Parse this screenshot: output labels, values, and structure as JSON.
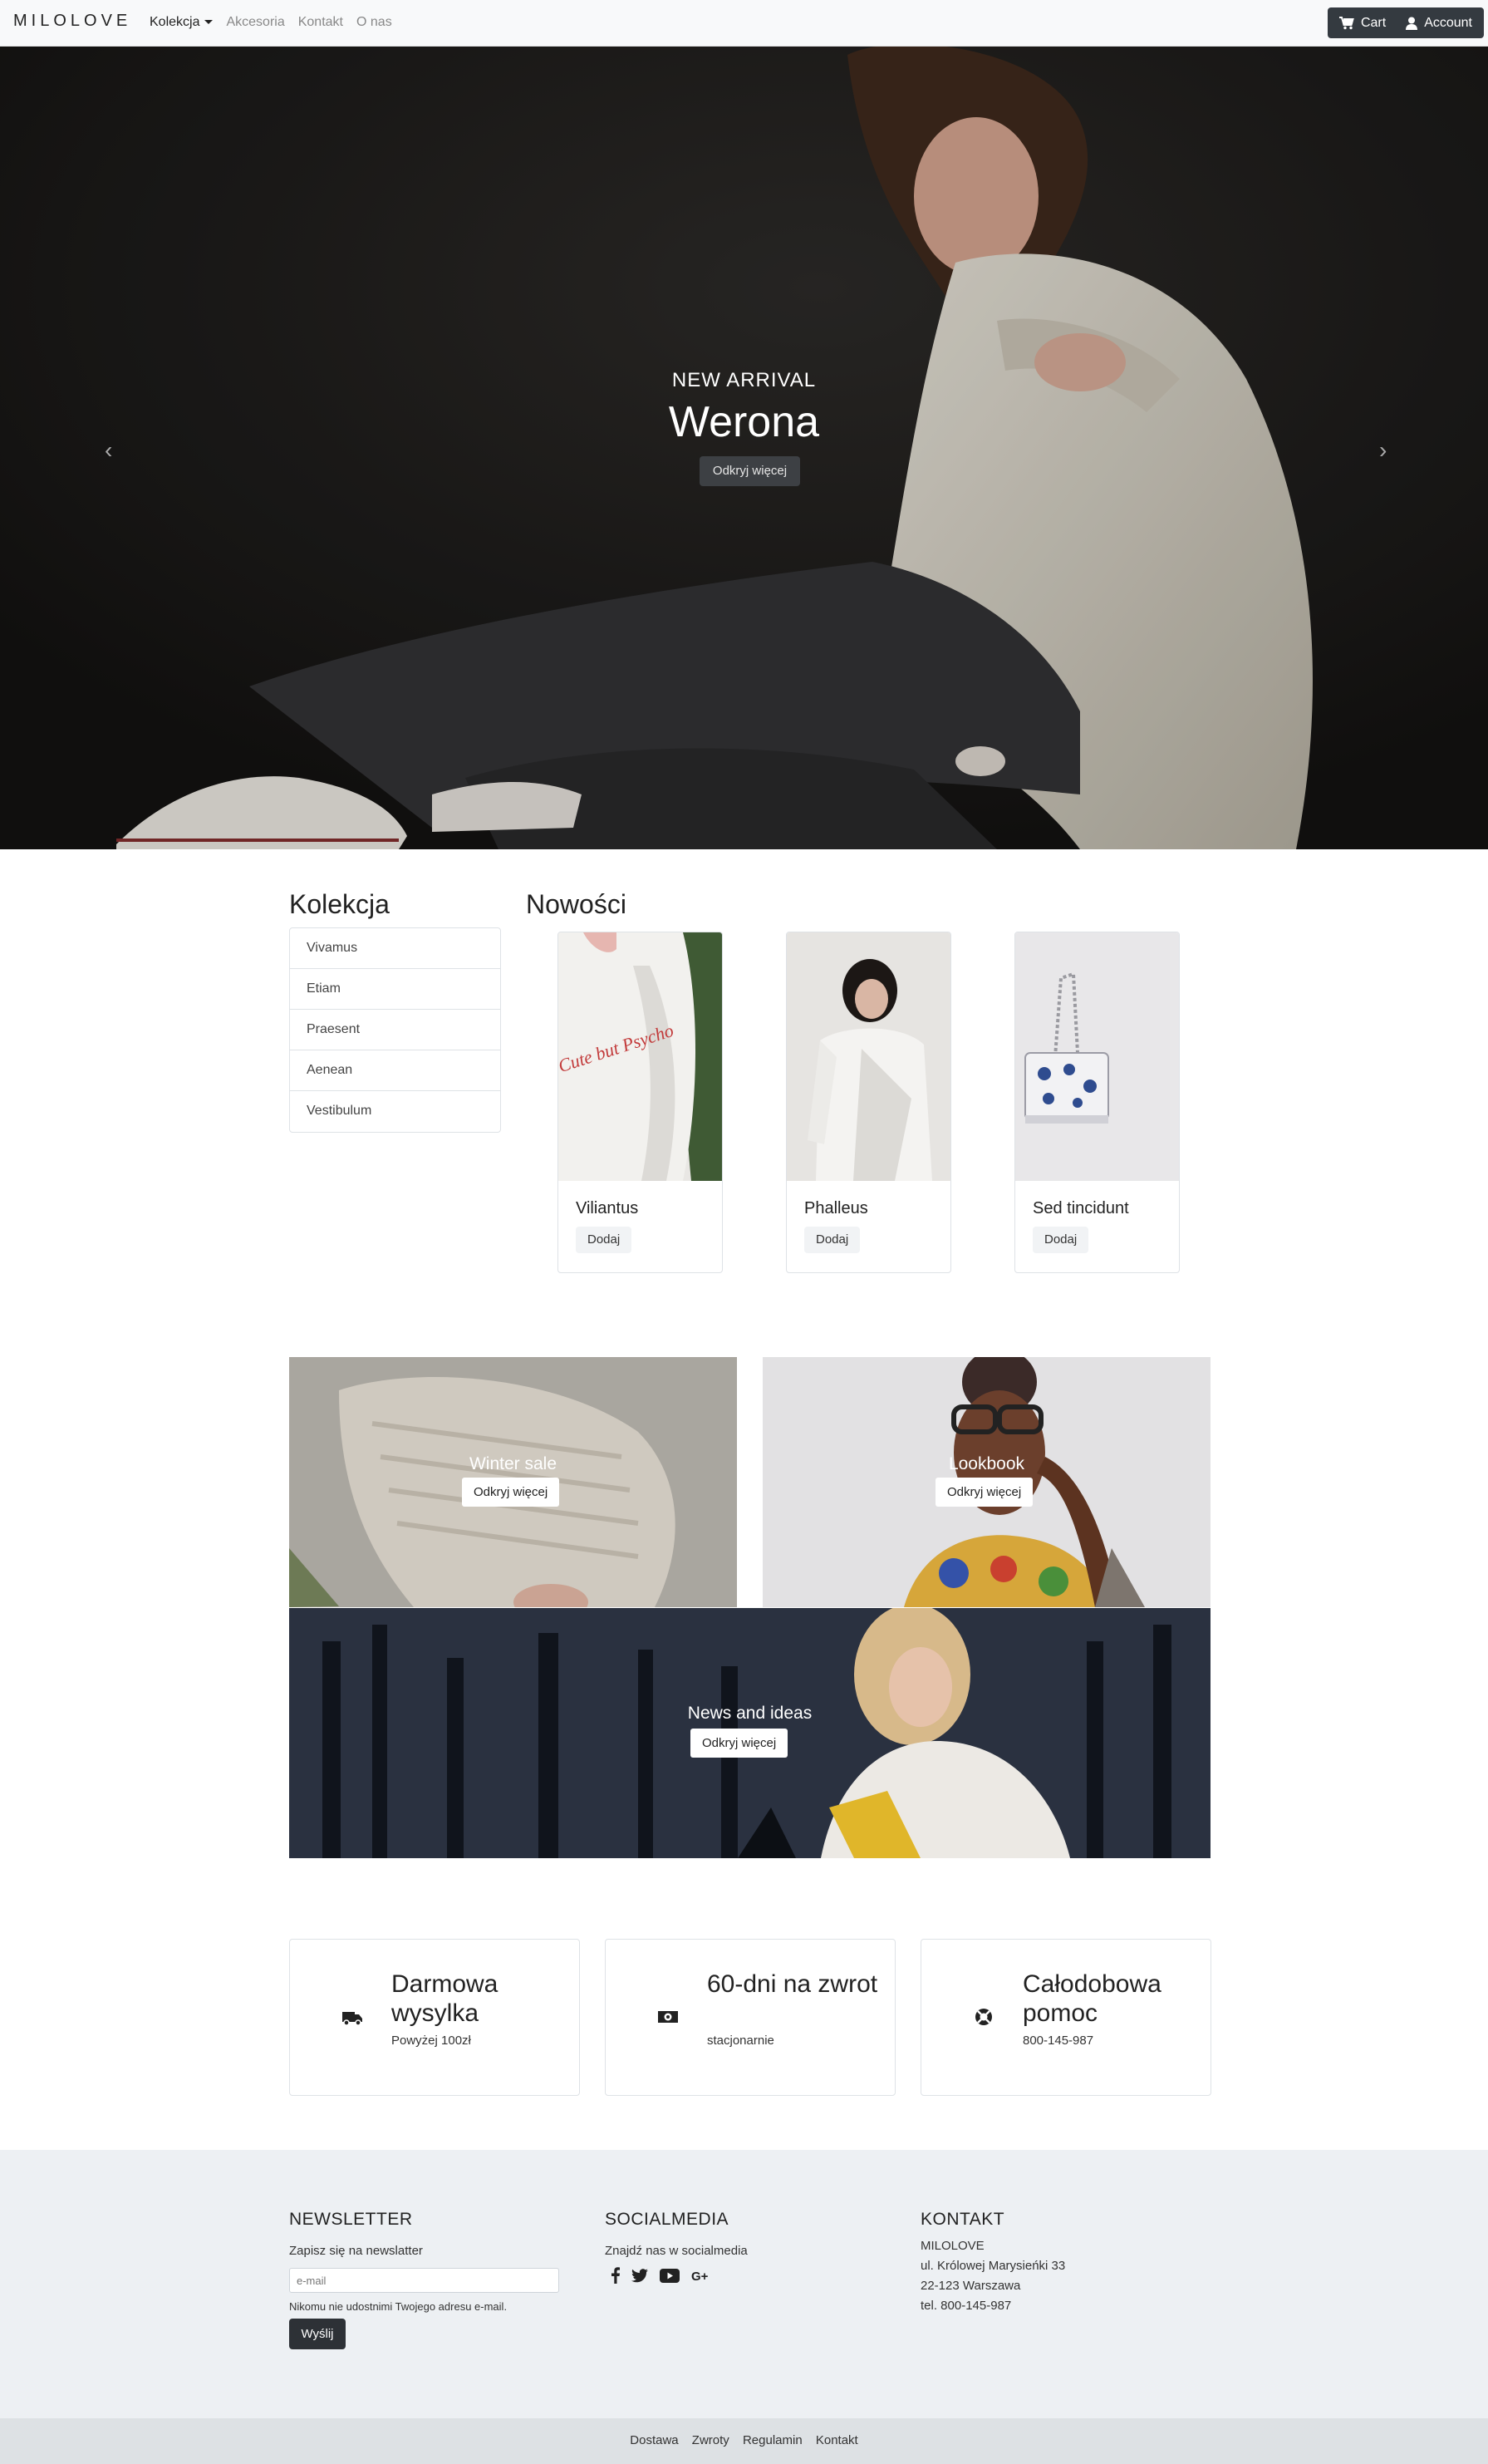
{
  "nav": {
    "brand": "MILOLOVE",
    "links": [
      "Kolekcja",
      "Akcesoria",
      "Kontakt",
      "O nas"
    ],
    "cart": "Cart",
    "account": "Account"
  },
  "hero": {
    "subtitle": "NEW ARRIVAL",
    "title": "Werona",
    "button": "Odkryj więcej"
  },
  "collection": {
    "heading": "Kolekcja",
    "items": [
      "Vivamus",
      "Etiam",
      "Praesent",
      "Aenean",
      "Vestibulum"
    ]
  },
  "news": {
    "heading": "Nowości",
    "products": [
      {
        "name": "Viliantus",
        "button": "Dodaj",
        "print": "Cute but Psycho"
      },
      {
        "name": "Phalleus",
        "button": "Dodaj"
      },
      {
        "name": "Sed tincidunt",
        "button": "Dodaj"
      }
    ]
  },
  "promos": [
    {
      "label": "Winter sale",
      "button": "Odkryj więcej"
    },
    {
      "label": "Lookbook",
      "button": "Odkryj więcej"
    },
    {
      "label": "News and ideas",
      "button": "Odkryj więcej"
    }
  ],
  "features": [
    {
      "title": "Darmowa wysylka",
      "subtitle": "Powyżej 100zł",
      "icon": "truck-icon"
    },
    {
      "title": "60-dni na zwrot",
      "subtitle": "stacjonarnie",
      "icon": "money-icon"
    },
    {
      "title": "Całodobowa pomoc",
      "subtitle": "800-145-987",
      "icon": "lifebuoy-icon"
    }
  ],
  "footer": {
    "newsletter": {
      "heading": "NEWSLETTER",
      "text": "Zapisz się na newslatter",
      "placeholder": "e-mail",
      "note": "Nikomu nie udostnimi Twojego adresu e-mail.",
      "button": "Wyślij"
    },
    "social": {
      "heading": "SOCIALMEDIA",
      "text": "Znajdź nas w socialmedia",
      "icons": [
        "facebook-icon",
        "twitter-icon",
        "youtube-icon",
        "google-plus-icon"
      ]
    },
    "contact": {
      "heading": "KONTAKT",
      "lines": [
        "MILOLOVE",
        "ul. Królowej Marysieńki 33",
        "22-123 Warszawa",
        "tel. 800-145-987"
      ]
    },
    "links": [
      "Dostawa",
      "Zwroty",
      "Regulamin",
      "Kontakt"
    ]
  },
  "colors": {
    "dark": "#343a40",
    "footer_bg": "#edf0f3",
    "bottom_bg": "#dde1e4"
  }
}
